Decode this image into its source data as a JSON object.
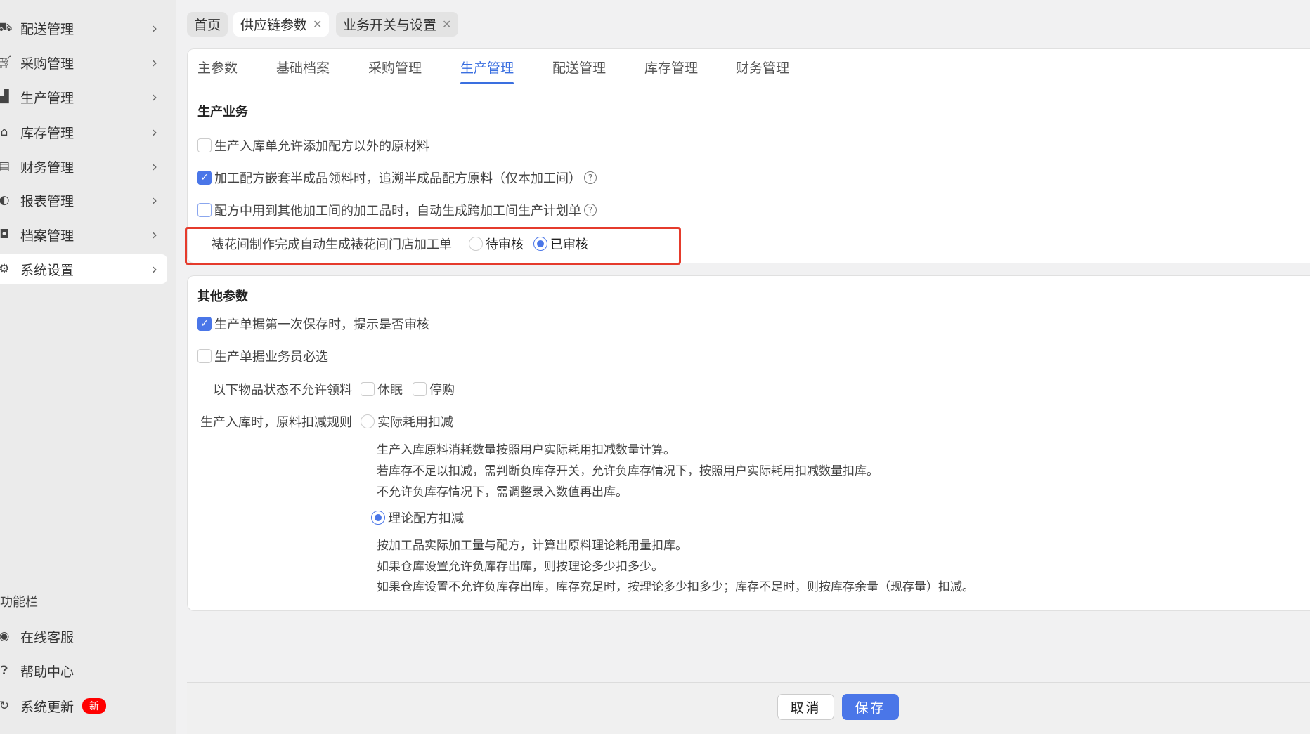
{
  "sidebar": {
    "items": [
      {
        "label": "配送管理",
        "icon": "truck-icon"
      },
      {
        "label": "采购管理",
        "icon": "cart-icon"
      },
      {
        "label": "生产管理",
        "icon": "chart-icon"
      },
      {
        "label": "库存管理",
        "icon": "warehouse-icon"
      },
      {
        "label": "财务管理",
        "icon": "finance-icon"
      },
      {
        "label": "报表管理",
        "icon": "globe-icon"
      },
      {
        "label": "档案管理",
        "icon": "archive-icon"
      },
      {
        "label": "系统设置",
        "icon": "gear-icon",
        "active": true
      }
    ],
    "section_label": "功能栏",
    "tools": [
      {
        "label": "在线客服",
        "icon": "headset-icon"
      },
      {
        "label": "帮助中心",
        "icon": "question-icon"
      },
      {
        "label": "系统更新",
        "icon": "refresh-icon",
        "badge": "新"
      }
    ]
  },
  "top_tabs": [
    {
      "label": "首页"
    },
    {
      "label": "供应链参数",
      "active": true
    },
    {
      "label": "业务开关与设置"
    }
  ],
  "panel_tabs": [
    "主参数",
    "基础档案",
    "采购管理",
    "生产管理",
    "配送管理",
    "库存管理",
    "财务管理"
  ],
  "active_panel_tab": "生产管理",
  "production": {
    "title": "生产业务",
    "opt1": {
      "label": "生产入库单允许添加配方以外的原材料",
      "checked": false
    },
    "opt2": {
      "label": "加工配方嵌套半成品领料时，追溯半成品配方原料（仅本加工间）",
      "checked": true
    },
    "opt3": {
      "label": "配方中用到其他加工间的加工品时，自动生成跨加工间生产计划单",
      "checked": false
    },
    "opt4": {
      "label": "裱花间制作完成自动生成裱花间门店加工单",
      "options": [
        "待审核",
        "已审核"
      ],
      "selected": "已审核"
    }
  },
  "other": {
    "title": "其他参数",
    "opt1": {
      "label": "生产单据第一次保存时，提示是否审核",
      "checked": true
    },
    "opt2": {
      "label": "生产单据业务员必选",
      "checked": false
    },
    "status_label": "以下物品状态不允许领料",
    "status_opts": [
      {
        "label": "休眠",
        "checked": false
      },
      {
        "label": "停购",
        "checked": false
      }
    ],
    "rule_label": "生产入库时，原料扣减规则",
    "rule1": {
      "label": "实际耗用扣减",
      "selected": false,
      "desc": [
        "生产入库原料消耗数量按照用户实际耗用扣减数量计算。",
        "若库存不足以扣减，需判断负库存开关，允许负库存情况下，按照用户实际耗用扣减数量扣库。",
        "不允许负库存情况下，需调整录入数值再出库。"
      ]
    },
    "rule2": {
      "label": "理论配方扣减",
      "selected": true,
      "desc": [
        "按加工品实际加工量与配方，计算出原料理论耗用量扣库。",
        "如果仓库设置允许负库存出库，则按理论多少扣多少。",
        "如果仓库设置不允许负库存出库，库存充足时，按理论多少扣多少；库存不足时，则按库存余量（现存量）扣减。"
      ]
    }
  },
  "footer": {
    "cancel": "取消",
    "save": "保存"
  },
  "colors": {
    "accent": "#4a76e8",
    "highlight_border": "#e53b2c",
    "badge": "#ff0000"
  }
}
